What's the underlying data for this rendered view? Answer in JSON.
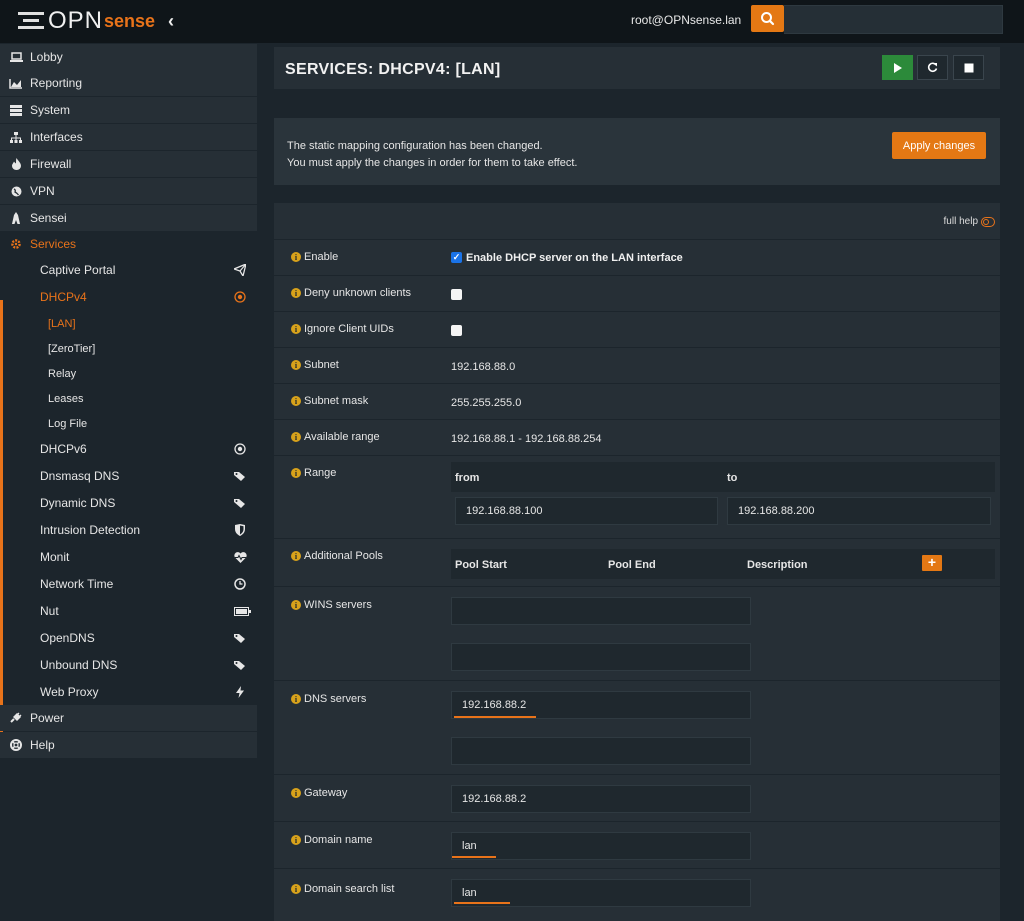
{
  "topbar": {
    "logo_main": "OPN",
    "logo_accent": "sense",
    "user": "root@OPNsense.lan",
    "search_placeholder": ""
  },
  "sidebar": {
    "items": [
      {
        "label": "Lobby",
        "icon": "laptop-icon"
      },
      {
        "label": "Reporting",
        "icon": "area-chart-icon"
      },
      {
        "label": "System",
        "icon": "server-icon"
      },
      {
        "label": "Interfaces",
        "icon": "sitemap-icon"
      },
      {
        "label": "Firewall",
        "icon": "fire-icon"
      },
      {
        "label": "VPN",
        "icon": "globe-icon"
      },
      {
        "label": "Sensei",
        "icon": "tower-icon"
      },
      {
        "label": "Services",
        "icon": "gear-icon"
      },
      {
        "label": "Power",
        "icon": "plug-icon"
      },
      {
        "label": "Help",
        "icon": "lifebuoy-icon"
      }
    ],
    "services_sub": [
      {
        "label": "Captive Portal",
        "icon": "paper-plane-icon"
      },
      {
        "label": "DHCPv4",
        "icon": "bullseye-icon"
      },
      {
        "label": "DHCPv6",
        "icon": "bullseye-icon"
      },
      {
        "label": "Dnsmasq DNS",
        "icon": "tags-icon"
      },
      {
        "label": "Dynamic DNS",
        "icon": "tags-icon"
      },
      {
        "label": "Intrusion Detection",
        "icon": "shield-icon"
      },
      {
        "label": "Monit",
        "icon": "heartbeat-icon"
      },
      {
        "label": "Network Time",
        "icon": "clock-icon"
      },
      {
        "label": "Nut",
        "icon": "battery-icon"
      },
      {
        "label": "OpenDNS",
        "icon": "tags-icon"
      },
      {
        "label": "Unbound DNS",
        "icon": "tags-icon"
      },
      {
        "label": "Web Proxy",
        "icon": "bolt-icon"
      }
    ],
    "dhcpv4_sub": [
      "[LAN]",
      "[ZeroTier]",
      "Relay",
      "Leases",
      "Log File"
    ]
  },
  "header": {
    "title": "SERVICES: DHCPV4: [LAN]"
  },
  "notice": {
    "line1": "The static mapping configuration has been changed.",
    "line2": "You must apply the changes in order for them to take effect.",
    "apply_label": "Apply changes"
  },
  "form": {
    "full_help": "full help",
    "enable": {
      "label": "Enable",
      "checkbox_label": "Enable DHCP server on the LAN interface",
      "checked": true
    },
    "deny_unknown": {
      "label": "Deny unknown clients",
      "checked": false
    },
    "ignore_uids": {
      "label": "Ignore Client UIDs",
      "checked": false
    },
    "subnet": {
      "label": "Subnet",
      "value": "192.168.88.0"
    },
    "subnet_mask": {
      "label": "Subnet mask",
      "value": "255.255.255.0"
    },
    "available_range": {
      "label": "Available range",
      "value": "192.168.88.1 - 192.168.88.254"
    },
    "range": {
      "label": "Range",
      "from_label": "from",
      "to_label": "to",
      "from": "192.168.88.100",
      "to": "192.168.88.200"
    },
    "pools": {
      "label": "Additional Pools",
      "col_start": "Pool Start",
      "col_end": "Pool End",
      "col_desc": "Description"
    },
    "wins": {
      "label": "WINS servers",
      "v1": "",
      "v2": ""
    },
    "dns": {
      "label": "DNS servers",
      "v1": "192.168.88.2",
      "v2": ""
    },
    "gateway": {
      "label": "Gateway",
      "value": "192.168.88.2"
    },
    "domain": {
      "label": "Domain name",
      "value": "lan"
    },
    "search": {
      "label": "Domain search list",
      "value": "lan"
    }
  },
  "colors": {
    "accent": "#e8731a",
    "play": "#2c8a3a"
  }
}
